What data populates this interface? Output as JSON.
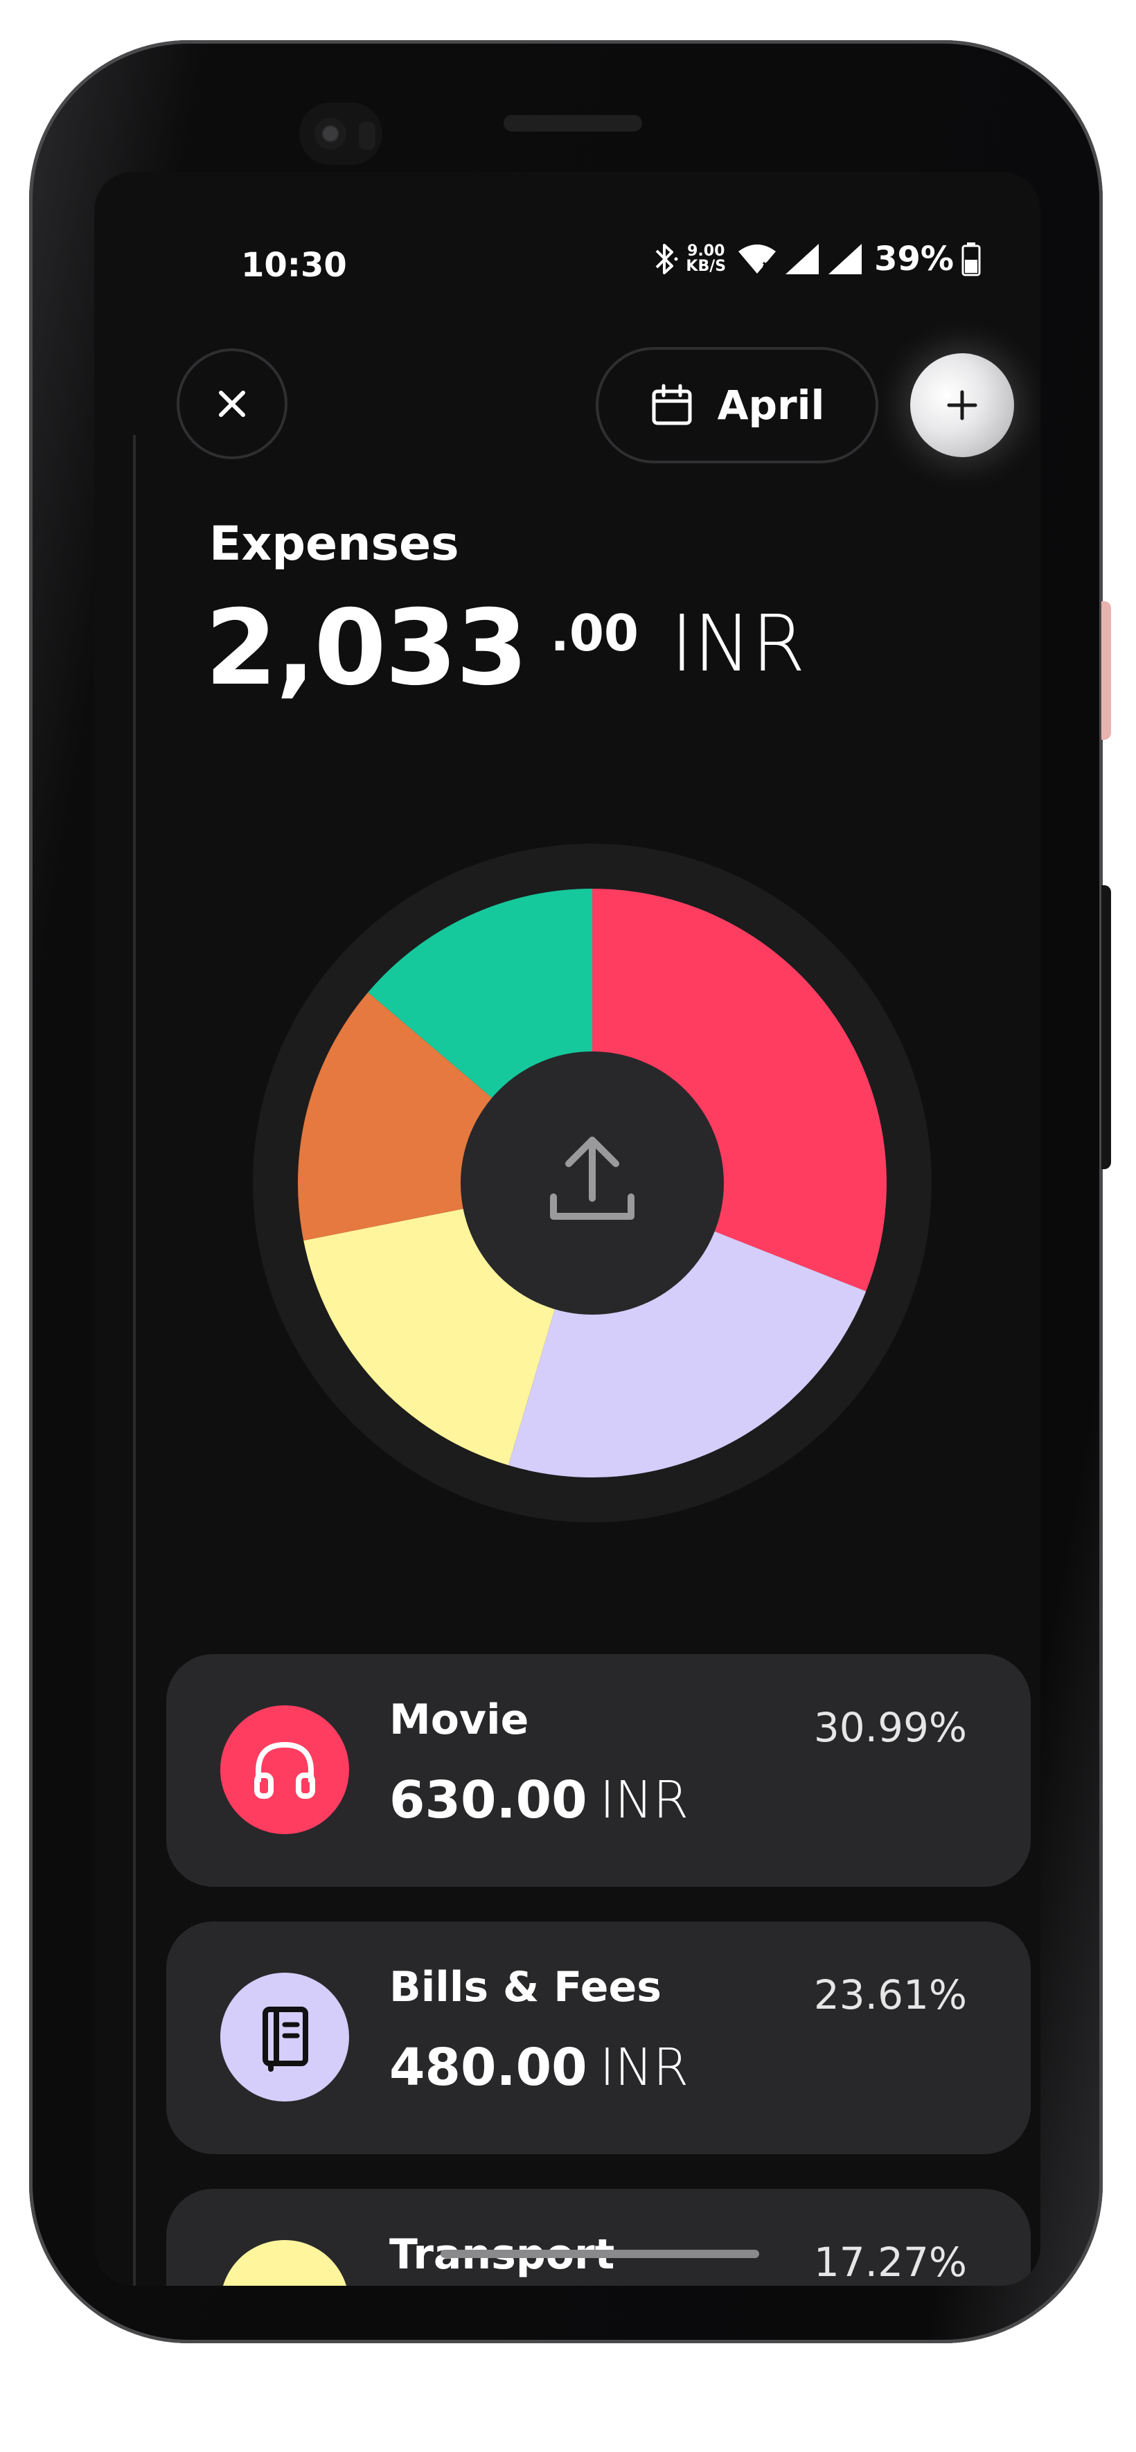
{
  "status_bar": {
    "time": "10:30",
    "net_speed_value": "9.00",
    "net_speed_unit": "KB/S",
    "battery": "39%"
  },
  "header": {
    "close_icon": "close-icon",
    "month_label": "April",
    "calendar_icon": "calendar-icon",
    "add_icon": "plus-icon"
  },
  "summary": {
    "label": "Expenses",
    "total_integer": "2,033",
    "total_decimal": ".00",
    "currency": "INR"
  },
  "chart_data": {
    "type": "pie",
    "style": "donut",
    "center_icon": "upload-icon",
    "slices": [
      {
        "value": 30.99,
        "color": "#ff3d61"
      },
      {
        "value": 23.61,
        "color": "#d5cefb"
      },
      {
        "value": 17.27,
        "color": "#fef59c"
      },
      {
        "value": 14.35,
        "color": "#e5793f"
      },
      {
        "value": 13.78,
        "color": "#16c99c"
      }
    ]
  },
  "categories": [
    {
      "name": "Movie",
      "amount": "630.00",
      "currency": "INR",
      "percent": "30.99%",
      "icon": "headphones-icon",
      "color": "#ff3d61"
    },
    {
      "name": "Bills & Fees",
      "amount": "480.00",
      "currency": "INR",
      "percent": "23.61%",
      "icon": "notebook-icon",
      "color": "#d5cefb"
    },
    {
      "name": "Transport",
      "amount": "",
      "currency": "",
      "percent": "17.27%",
      "icon": "car-icon",
      "color": "#fef59c"
    }
  ]
}
